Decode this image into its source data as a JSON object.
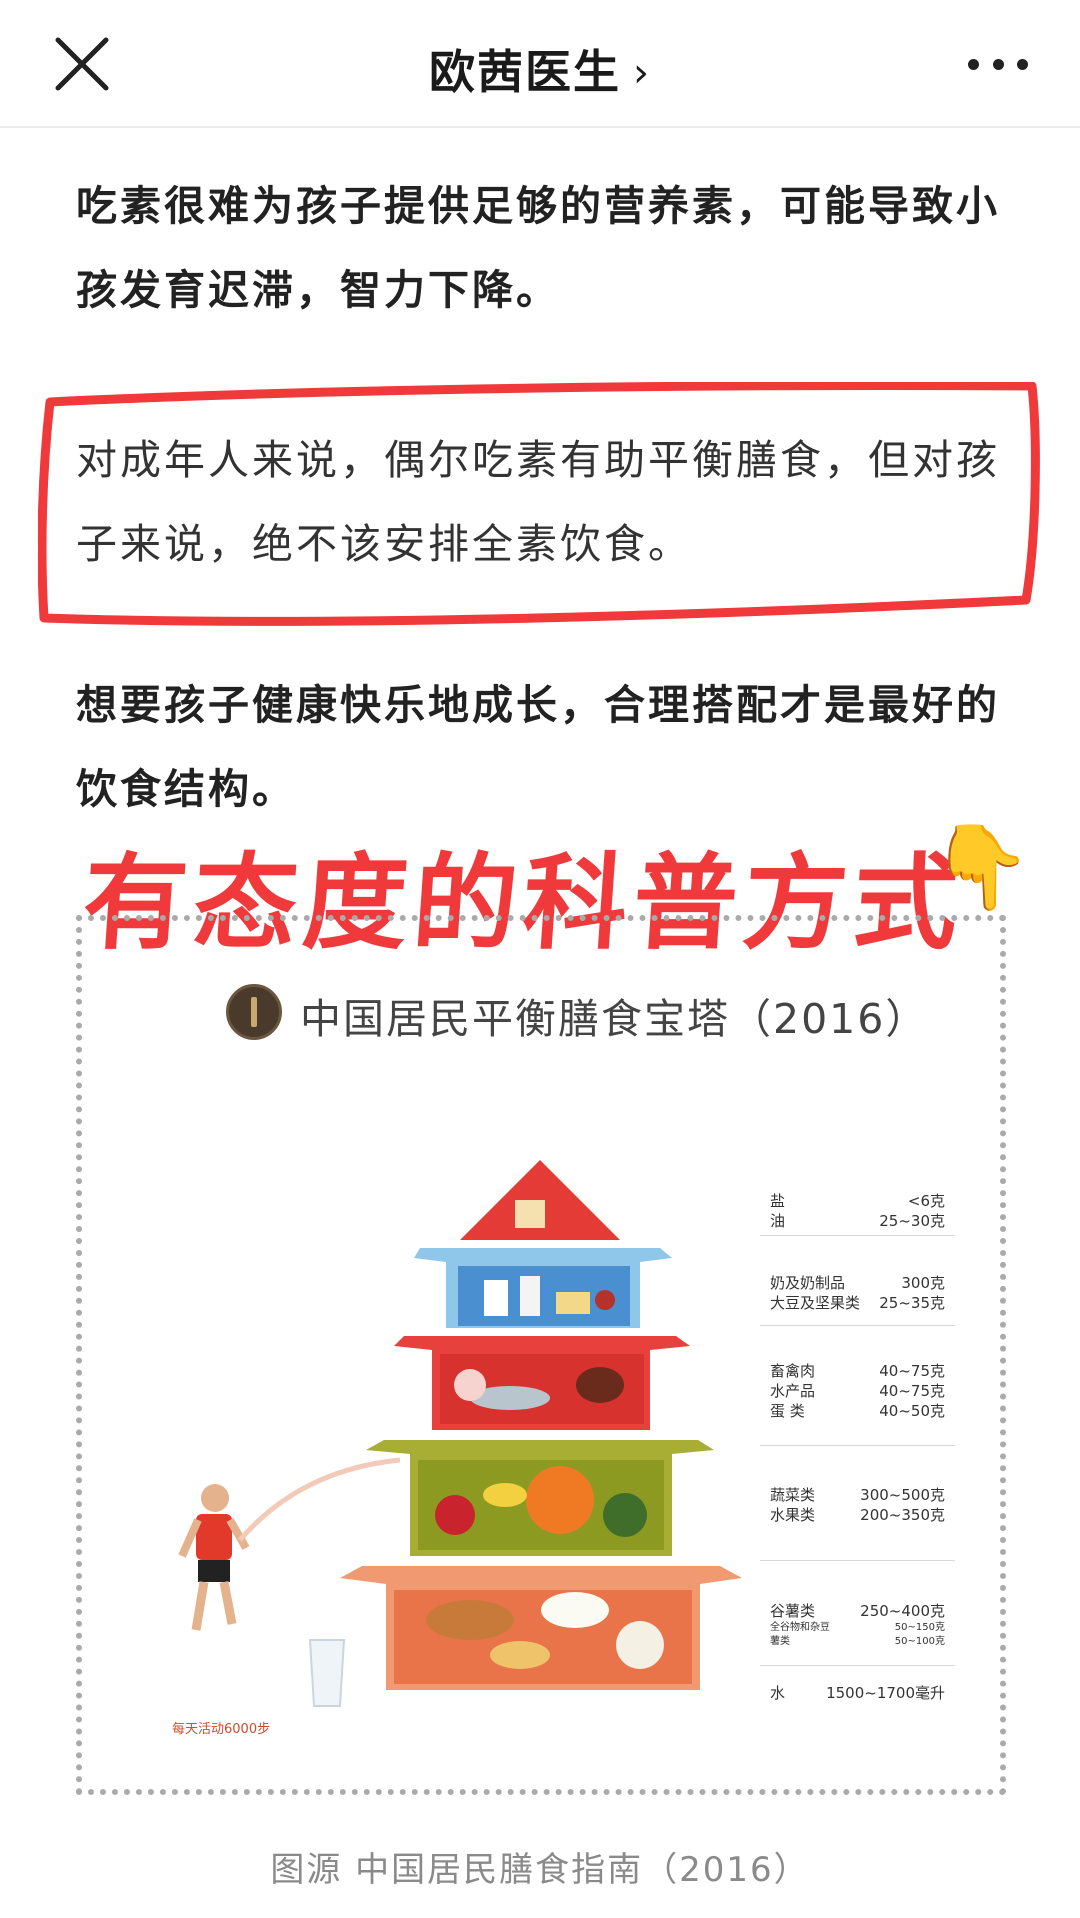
{
  "nav": {
    "title": "欧茜医生",
    "chevron": "›",
    "close_icon": "close-icon",
    "more_icon": "more-dots-icon"
  },
  "article": {
    "p1": "吃素很难为孩子提供足够的营养素，可能导致小孩发育迟滞，智力下降。",
    "p2": "对成年人来说，偶尔吃素有助平衡膳食，但对孩子来说，绝不该安排全素饮食。",
    "p3": "想要孩子健康快乐地成长，合理搭配才是最好的饮食结构。",
    "banner": "有态度的科普方式",
    "banner_emoji": "👇",
    "highlight_color": "#f0393a"
  },
  "pyramid": {
    "title": "中国居民平衡膳食宝塔（2016）",
    "activity": "每天活动6000步",
    "legend": [
      {
        "name": "盐",
        "amount": "<6克"
      },
      {
        "name": "油",
        "amount": "25~30克"
      },
      {
        "name": "奶及奶制品",
        "amount": "300克"
      },
      {
        "name": "大豆及坚果类",
        "amount": "25~35克"
      },
      {
        "name": "畜禽肉",
        "amount": "40~75克"
      },
      {
        "name": "水产品",
        "amount": "40~75克"
      },
      {
        "name": "蛋 类",
        "amount": "40~50克"
      },
      {
        "name": "蔬菜类",
        "amount": "300~500克"
      },
      {
        "name": "水果类",
        "amount": "200~350克"
      },
      {
        "name": "谷薯类",
        "amount": "250~400克"
      },
      {
        "name": "全谷物和杂豆",
        "amount": "50~150克"
      },
      {
        "name": "薯类",
        "amount": "50~100克"
      },
      {
        "name": "水",
        "amount": "1500~1700毫升"
      }
    ]
  },
  "caption": "图源 中国居民膳食指南（2016）"
}
